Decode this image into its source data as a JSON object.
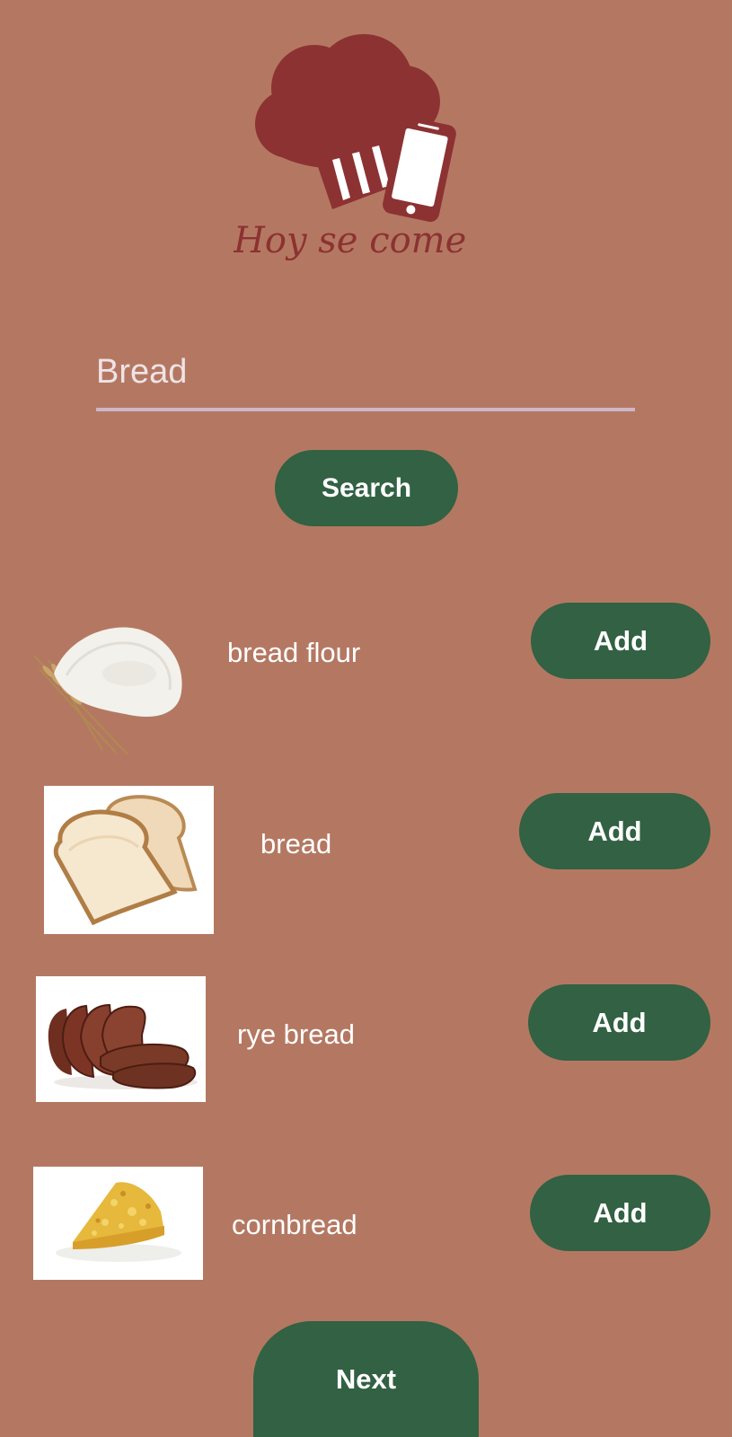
{
  "logo": {
    "brand_text": "Hoy se come",
    "colors": {
      "primary": "#8c3232",
      "phone_screen": "#ffffff"
    }
  },
  "search": {
    "value": "Bread",
    "button_label": "Search"
  },
  "results": [
    {
      "label": "bread flour",
      "thumbnail": "flour-image",
      "add_label": "Add"
    },
    {
      "label": "bread",
      "thumbnail": "bread-slices-image",
      "add_label": "Add"
    },
    {
      "label": "rye bread",
      "thumbnail": "rye-bread-image",
      "add_label": "Add"
    },
    {
      "label": "cornbread",
      "thumbnail": "cornbread-image",
      "add_label": "Add"
    }
  ],
  "footer": {
    "next_label": "Next"
  },
  "colors": {
    "background": "#b47862",
    "button": "#326143",
    "underline": "#cdb5c7",
    "text": "#ffffff"
  }
}
